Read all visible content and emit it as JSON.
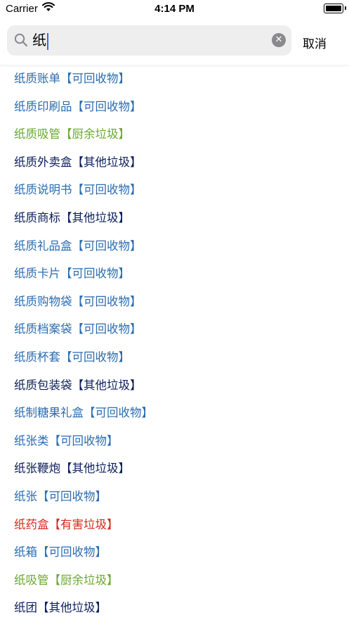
{
  "status_bar": {
    "carrier": "Carrier",
    "time": "4:14 PM"
  },
  "search": {
    "query": "纸",
    "cancel_label": "取消"
  },
  "colors": {
    "可回收物": "#2b6cb0",
    "厨余垃圾": "#6aa82f",
    "其他垃圾": "#0c1f5c",
    "有害垃圾": "#d6281d"
  },
  "results": [
    {
      "text": "纸质账单【可回收物】",
      "category": "可回收物"
    },
    {
      "text": "纸质印刷品【可回收物】",
      "category": "可回收物"
    },
    {
      "text": "纸质吸管【厨余垃圾】",
      "category": "厨余垃圾"
    },
    {
      "text": "纸质外卖盒【其他垃圾】",
      "category": "其他垃圾"
    },
    {
      "text": "纸质说明书【可回收物】",
      "category": "可回收物"
    },
    {
      "text": "纸质商标【其他垃圾】",
      "category": "其他垃圾"
    },
    {
      "text": "纸质礼品盒【可回收物】",
      "category": "可回收物"
    },
    {
      "text": "纸质卡片【可回收物】",
      "category": "可回收物"
    },
    {
      "text": "纸质购物袋【可回收物】",
      "category": "可回收物"
    },
    {
      "text": "纸质档案袋【可回收物】",
      "category": "可回收物"
    },
    {
      "text": "纸质杯套【可回收物】",
      "category": "可回收物"
    },
    {
      "text": "纸质包装袋【其他垃圾】",
      "category": "其他垃圾"
    },
    {
      "text": "纸制糖果礼盒【可回收物】",
      "category": "可回收物"
    },
    {
      "text": "纸张类【可回收物】",
      "category": "可回收物"
    },
    {
      "text": "纸张鞭炮【其他垃圾】",
      "category": "其他垃圾"
    },
    {
      "text": "纸张【可回收物】",
      "category": "可回收物"
    },
    {
      "text": "纸药盒【有害垃圾】",
      "category": "有害垃圾"
    },
    {
      "text": "纸箱【可回收物】",
      "category": "可回收物"
    },
    {
      "text": "纸吸管【厨余垃圾】",
      "category": "厨余垃圾"
    },
    {
      "text": "纸团【其他垃圾】",
      "category": "其他垃圾"
    }
  ]
}
